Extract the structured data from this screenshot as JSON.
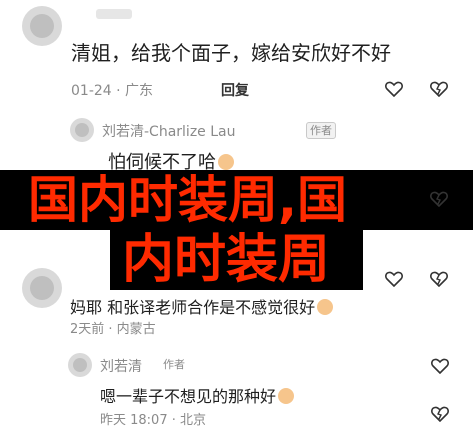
{
  "comments": [
    {
      "text": "清姐，给我个面子，嫁给安欣好不好",
      "meta": "01-24 · 广东",
      "reply_label": "回复"
    }
  ],
  "reply_1": {
    "author": "刘若清-Charlize Lau",
    "badge": "作者",
    "text": "怕伺候不了哈"
  },
  "overlay": {
    "line1": "国内时装周,国",
    "line2": "内时装周"
  },
  "comment_2": {
    "text": "妈耶 和张译老师合作是不感觉很好",
    "meta": "2天前 · 内蒙古"
  },
  "reply_2": {
    "author": "刘若清",
    "badge": "作者",
    "text": "嗯一辈子不想见的那种好",
    "meta": "昨天 18:07 · 北京"
  },
  "icons": [
    "avatar",
    "heart-icon",
    "dislike-icon",
    "emoji-icon"
  ],
  "colors": {
    "overlay_bg": "#000000",
    "overlay_text": "#ff2a00",
    "meta_gray": "#8a8a8a"
  }
}
